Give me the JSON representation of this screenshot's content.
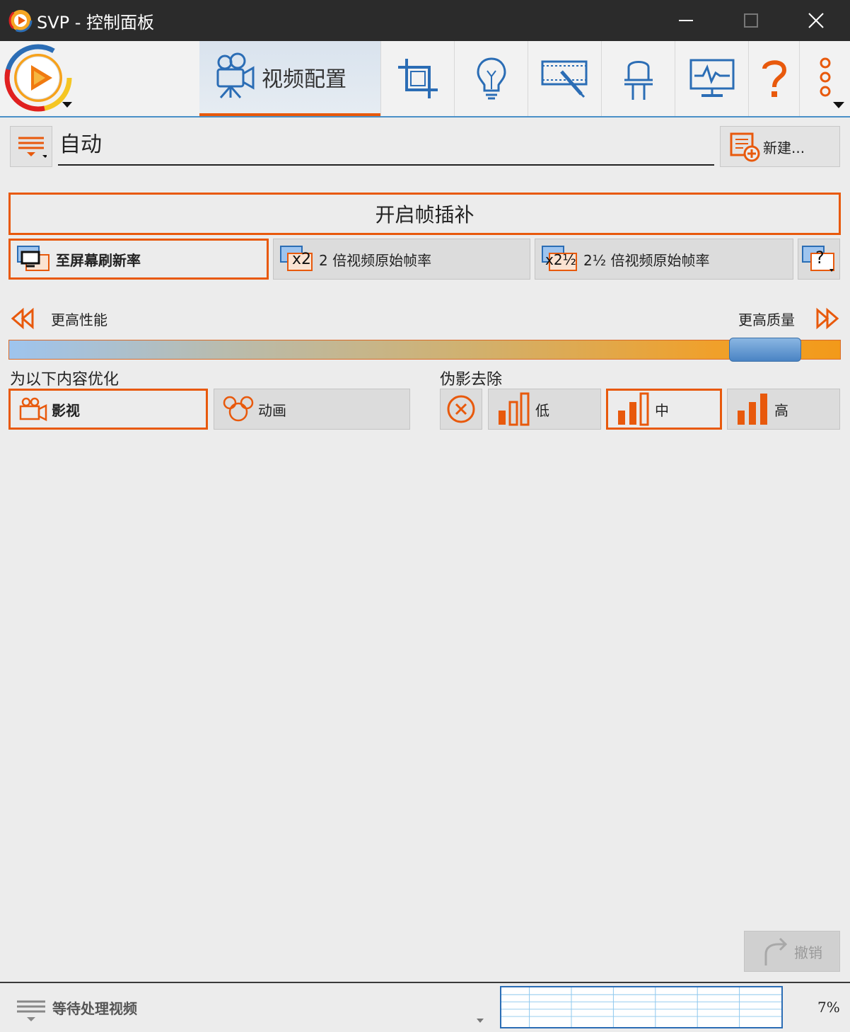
{
  "window": {
    "title": "SVP - 控制面板"
  },
  "toolbar": {
    "active_tab_label": "视频配置",
    "tools": [
      "crop-icon",
      "lightbulb-icon",
      "film-edit-icon",
      "led-icon",
      "monitor-pulse-icon",
      "help-icon",
      "more-icon"
    ]
  },
  "profile": {
    "name": "自动",
    "new_label": "新建..."
  },
  "interpolation": {
    "enable_label": "开启帧插补",
    "rate_options": [
      {
        "badge": "",
        "label": "至屏幕刷新率",
        "selected": true
      },
      {
        "badge": "x2",
        "label": "2 倍视频原始帧率",
        "selected": false
      },
      {
        "badge": "x2½",
        "label": "2½ 倍视频原始帧率",
        "selected": false
      }
    ],
    "custom_badge": "?"
  },
  "slider": {
    "left_label": "更高性能",
    "right_label": "更高质量",
    "value_fraction": 0.95
  },
  "optimize": {
    "label": "为以下内容优化",
    "options": [
      {
        "label": "影视",
        "selected": true
      },
      {
        "label": "动画",
        "selected": false
      }
    ]
  },
  "artifacts": {
    "label": "伪影去除",
    "options": [
      {
        "label": "低",
        "selected": false
      },
      {
        "label": "中",
        "selected": true
      },
      {
        "label": "高",
        "selected": false
      }
    ]
  },
  "undo_label": "撤销",
  "status": {
    "text": "等待处理视频",
    "load_percent": "7%"
  },
  "colors": {
    "accent": "#e8590c",
    "blue": "#2b6db5"
  }
}
